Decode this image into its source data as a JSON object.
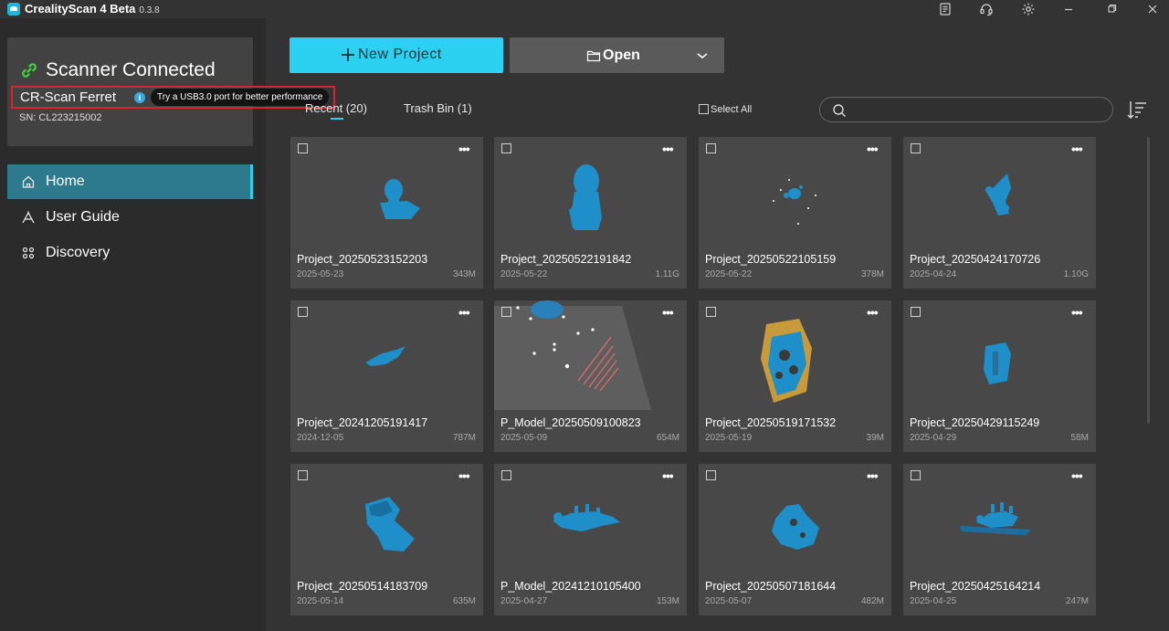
{
  "app": {
    "title": "CrealityScan 4 Beta",
    "version": "0.3.8"
  },
  "titlebar_icons": [
    "document-icon",
    "headset-icon",
    "settings-gear-icon",
    "minimize-icon",
    "restore-icon",
    "close-icon"
  ],
  "scanner": {
    "status": "Scanner Connected",
    "model": "CR-Scan Ferret",
    "tip": "Try a USB3.0 port for better performance",
    "sn": "SN: CL223215002"
  },
  "nav": [
    {
      "label": "Home",
      "icon": "home-icon",
      "active": true
    },
    {
      "label": "User Guide",
      "icon": "user-guide-icon",
      "active": false
    },
    {
      "label": "Discovery",
      "icon": "discovery-icon",
      "active": false
    }
  ],
  "toolbar": {
    "new_project": "New Project",
    "open": "Open"
  },
  "tabs": {
    "recent": "Recent (20)",
    "trash": "Trash Bin (1)"
  },
  "select_all": "Select All",
  "search": {
    "placeholder": ""
  },
  "colors": {
    "accent": "#2cd0f0",
    "model_blue": "#1e8fc8",
    "highlight_border": "#d7252f"
  },
  "projects": [
    {
      "name": "Project_20250523152203",
      "date": "2025-05-23",
      "size": "343M"
    },
    {
      "name": "Project_20250522191842",
      "date": "2025-05-22",
      "size": "1.11G"
    },
    {
      "name": "Project_20250522105159",
      "date": "2025-05-22",
      "size": "378M"
    },
    {
      "name": "Project_20250424170726",
      "date": "2025-04-24",
      "size": "1.10G"
    },
    {
      "name": "Project_20241205191417",
      "date": "2024-12-05",
      "size": "787M"
    },
    {
      "name": "P_Model_20250509100823",
      "date": "2025-05-09",
      "size": "654M"
    },
    {
      "name": "Project_20250519171532",
      "date": "2025-05-19",
      "size": "39M"
    },
    {
      "name": "Project_20250429115249",
      "date": "2025-04-29",
      "size": "58M"
    },
    {
      "name": "Project_20250514183709",
      "date": "2025-05-14",
      "size": "635M"
    },
    {
      "name": "P_Model_20241210105400",
      "date": "2025-04-27",
      "size": "153M"
    },
    {
      "name": "Project_20250507181644",
      "date": "2025-05-07",
      "size": "482M"
    },
    {
      "name": "Project_20250425164214",
      "date": "2025-04-25",
      "size": "247M"
    }
  ]
}
